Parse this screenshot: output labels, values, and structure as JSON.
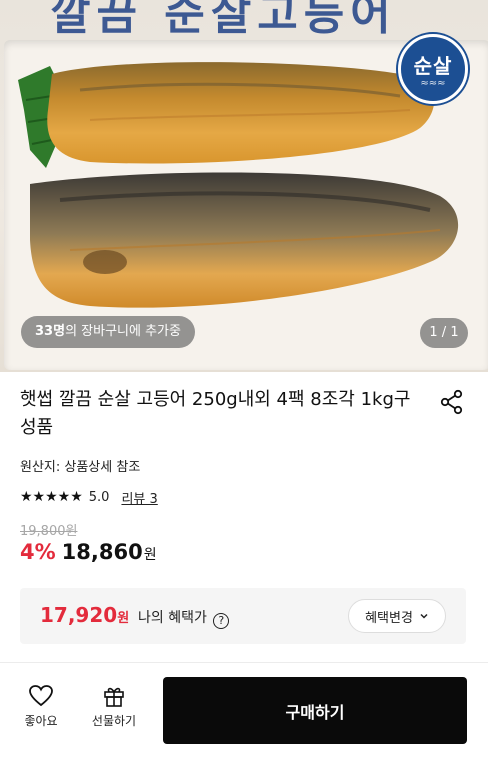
{
  "hero": {
    "badge_text": "순살",
    "cart_count": "33명",
    "cart_suffix": "의 장바구니에 추가중",
    "page_indicator": "1 / 1",
    "top_banner_text": "깔끔 순살고등어"
  },
  "product": {
    "title": "햇썹 깔끔 순살 고등어 250g내외 4팩 8조각 1kg구성품",
    "origin": "원산지: 상품상세 참조",
    "stars": "★★★★★",
    "rating": "5.0",
    "review_label": "리뷰 3",
    "original_price": "19,800원",
    "discount": "4%",
    "sale_price": "18,860",
    "currency": "원"
  },
  "benefit": {
    "price": "17,920",
    "currency": "원",
    "label": "나의 혜택가",
    "info_icon": "?",
    "change_button": "혜택변경"
  },
  "bottom_bar": {
    "like_label": "좋아요",
    "gift_label": "선물하기",
    "buy_label": "구매하기"
  },
  "colors": {
    "accent_red": "#e32b3c",
    "badge_blue": "#1c4f93",
    "buy_button": "#0a0a0a"
  },
  "icons": {
    "share": "share-icon",
    "heart": "heart-icon",
    "gift": "gift-icon",
    "chevron": "chevron-down-icon",
    "info": "info-icon"
  }
}
